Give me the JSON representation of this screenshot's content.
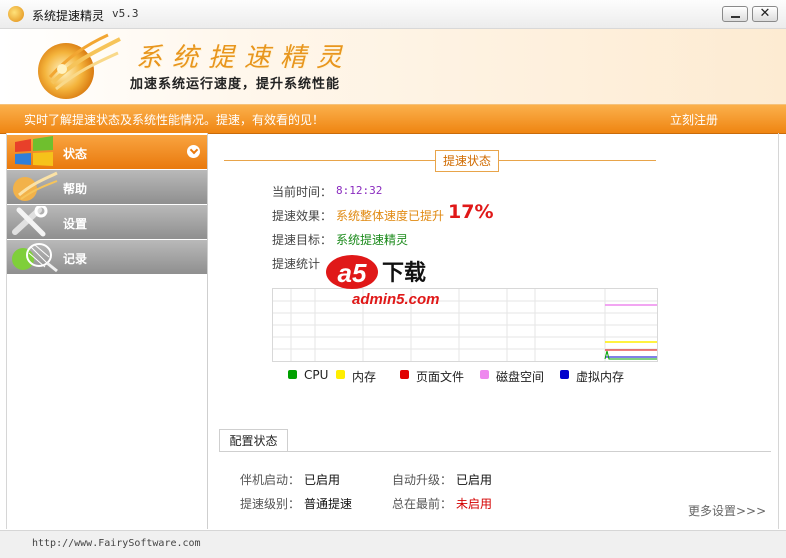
{
  "window": {
    "title": "系统提速精灵",
    "version": "v5.3",
    "close_symbol": "✕"
  },
  "banner": {
    "brand": "系统提速精灵",
    "slogan": "加速系统运行速度，提升系统性能"
  },
  "topbar": {
    "tip": "实时了解提速状态及系统性能情况。提速，有效看的见！",
    "register": "立刻注册"
  },
  "sidebar": {
    "items": [
      {
        "label": "状态",
        "active": true
      },
      {
        "label": "帮助",
        "active": false
      },
      {
        "label": "设置",
        "active": false
      },
      {
        "label": "记录",
        "active": false
      }
    ]
  },
  "status": {
    "section_title": "提速状态",
    "time_label": "当前时间：",
    "time_value": "8:12:32",
    "effect_label": "提速效果：",
    "effect_text": "系统整体速度已提升",
    "effect_percent": "17%",
    "target_label": "提速目标：",
    "target_value": "系统提速精灵",
    "stats_label": "提速统计"
  },
  "chart_data": {
    "type": "line",
    "title": "",
    "series": [
      {
        "name": "CPU",
        "color": "#00a000"
      },
      {
        "name": "内存",
        "color": "#ffee00"
      },
      {
        "name": "页面文件",
        "color": "#e00000"
      },
      {
        "name": "磁盘空间",
        "color": "#ee88ee"
      },
      {
        "name": "虚拟内存",
        "color": "#0000cc"
      }
    ]
  },
  "watermark": {
    "logo_text": "a5",
    "suffix": "下载",
    "domain": "admin5.com"
  },
  "config": {
    "tab_label": "配置状态",
    "boot_label": "伴机启动：",
    "boot_value": "已启用",
    "upgrade_label": "自动升级：",
    "upgrade_value": "已启用",
    "level_label": "提速级别：",
    "level_value": "普通提速",
    "top_label": "总在最前：",
    "top_value": "未启用",
    "more_link": "更多设置>>>"
  },
  "statusbar": {
    "url": "http://www.FairySoftware.com"
  }
}
